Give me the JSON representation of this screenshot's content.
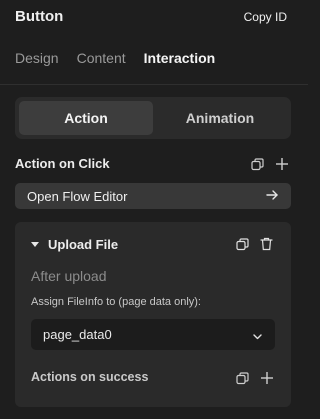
{
  "header": {
    "title": "Button",
    "copy_id": "Copy ID"
  },
  "tabs": [
    {
      "label": "Design",
      "active": false
    },
    {
      "label": "Content",
      "active": false
    },
    {
      "label": "Interaction",
      "active": true
    }
  ],
  "segment": {
    "items": [
      "Action",
      "Animation"
    ],
    "selected": "Action"
  },
  "action_on_click": {
    "label": "Action on Click",
    "icons": [
      "duplicate-icon",
      "plus-icon"
    ],
    "open_flow_editor": "Open Flow Editor"
  },
  "upload_card": {
    "title": "Upload File",
    "expanded": true,
    "after_upload": "After upload",
    "assign_label": "Assign FileInfo to (page data only):",
    "select_value": "page_data0",
    "success_label": "Actions on success"
  },
  "colors": {
    "background": "#1e1e1e",
    "card": "#2a2a2a",
    "button": "#383838",
    "segment_active": "#3d3d3d"
  }
}
